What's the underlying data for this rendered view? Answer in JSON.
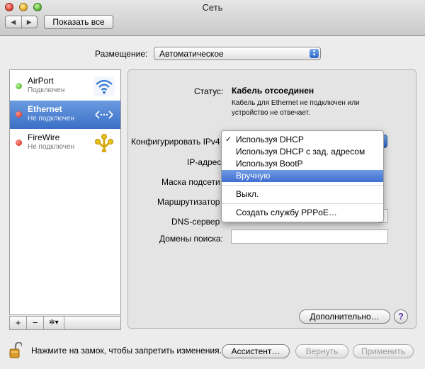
{
  "window": {
    "title": "Сеть"
  },
  "toolbar": {
    "back_label": "◀",
    "forward_label": "▶",
    "show_all_label": "Показать все"
  },
  "location": {
    "label": "Размещение:",
    "value": "Автоматическое"
  },
  "sidebar": {
    "items": [
      {
        "name": "AirPort",
        "status": "Подключен",
        "dot_color": "#3ea81c",
        "icon": "wifi-icon"
      },
      {
        "name": "Ethernet",
        "status": "Не подключен",
        "dot_color": "#d01e10",
        "icon": "ethernet-icon",
        "selected": true
      },
      {
        "name": "FireWire",
        "status": "Не подключен",
        "dot_color": "#d01e10",
        "icon": "firewire-icon"
      }
    ],
    "add_label": "+",
    "remove_label": "−",
    "action_label": "✲▾"
  },
  "detail": {
    "status_label": "Статус:",
    "status_value": "Кабель отсоединен",
    "status_description": "Кабель для Ethernet не подключен или устройство не отвечает.",
    "configure_label": "Конфигурировать IPv4",
    "ip_label": "IP-адрес",
    "mask_label": "Маска подсети",
    "router_label": "Маршрутизатор",
    "dns_label": "DNS-сервер",
    "search_domains_label": "Домены поиска:",
    "search_domains_value": "",
    "advanced_label": "Дополнительно…",
    "help_label": "?"
  },
  "configure_menu": {
    "items": [
      {
        "label": "Используя DHCP",
        "checked": true
      },
      {
        "label": "Используя DHCP с зад. адресом"
      },
      {
        "label": "Используя BootP"
      },
      {
        "label": "Вручную",
        "highlighted": true
      },
      {
        "label": "Выкл."
      },
      {
        "label": "Создать службу PPPoE…"
      }
    ]
  },
  "bottom": {
    "lock_text": "Нажмите на замок, чтобы запретить изменения.",
    "assistant_label": "Ассистент…",
    "revert_label": "Вернуть",
    "apply_label": "Применить"
  },
  "colors": {
    "selection": "#3a6fc6",
    "menu_highlight": "#3f6fd1",
    "connected": "#3ea81c",
    "disconnected": "#d01e10"
  }
}
